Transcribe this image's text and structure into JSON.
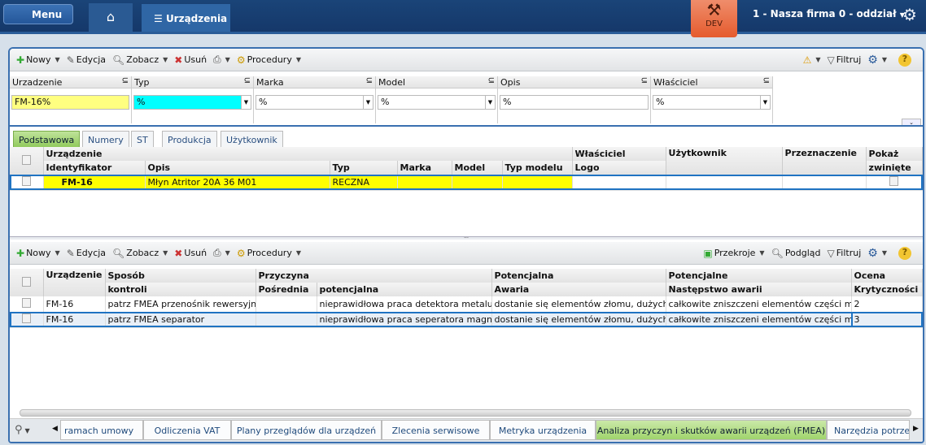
{
  "topbar": {
    "menu_label": "Menu",
    "home_icon": "home-icon",
    "active_tab": "Urządzenia",
    "dev_label": "DEV",
    "company": "1 - Nasza firma 0 - oddział",
    "colors": {
      "bar": "#16396a",
      "dev": "#e8623a"
    }
  },
  "toolbar1": {
    "new": "Nowy",
    "edit": "Edycja",
    "view": "Zobacz",
    "delete": "Usuń",
    "procedures": "Procedury",
    "filter": "Filtruj"
  },
  "filters": [
    {
      "label": "Urzadzenie",
      "value": "FM-16%"
    },
    {
      "label": "Typ",
      "value": "%"
    },
    {
      "label": "Marka",
      "value": "%"
    },
    {
      "label": "Model",
      "value": "%"
    },
    {
      "label": "Opis",
      "value": "%"
    },
    {
      "label": "Właściciel",
      "value": "%"
    }
  ],
  "tabs1": [
    "Podstawowa",
    "Numery",
    "ST",
    "Produkcja",
    "Użytkownik"
  ],
  "grid1": {
    "group": "Urządzenie",
    "headers": [
      "Identyfikator",
      "Opis",
      "Typ",
      "Marka",
      "Model",
      "Typ modelu"
    ],
    "owner": "Właściciel",
    "logo": "Logo",
    "user": "Użytkownik",
    "purpose": "Przeznaczenie",
    "show1": "Pokaż",
    "show2": "zwinięte",
    "rows": [
      {
        "id": "FM-16",
        "opis": "Młyn Atritor 20A  36 M01",
        "typ": "RECZNA"
      }
    ]
  },
  "toolbar2": {
    "new": "Nowy",
    "edit": "Edycja",
    "view": "Zobacz",
    "delete": "Usuń",
    "procedures": "Procedury",
    "sections": "Przekroje",
    "preview": "Podgląd",
    "filter": "Filtruj"
  },
  "grid2": {
    "h": {
      "dev": "Urządzenie",
      "method1": "Sposób",
      "method2": "kontroli",
      "cause": "Przyczyna",
      "indirect": "Pośrednia",
      "potential": "potencjalna",
      "pot1": "Potencjalna",
      "failure": "Awaria",
      "pot2": "Potencjalne",
      "consequence": "Następstwo awarii",
      "rating1": "Ocena",
      "rating2": "Krytyczności"
    },
    "rows": [
      {
        "dev": "FM-16",
        "method": "patrz FMEA przenośnik rewersyjny z",
        "indirect": "",
        "potential": "nieprawidłowa praca detektora metalu",
        "failure": "dostanie się elementów złomu, dużych kar",
        "consequence": "całkowite zniszczeni elementów części młyna",
        "rating": "2"
      },
      {
        "dev": "FM-16",
        "method": "patrz FMEA separator",
        "indirect": "",
        "potential": "nieprawidłowa praca seperatora magnetyc",
        "failure": "dostanie się elementów złomu, dużych kar",
        "consequence": "całkowite zniszczeni elementów części młyna",
        "rating": "3"
      }
    ]
  },
  "bottom_tabs": [
    "ramach umowy",
    "Odliczenia VAT",
    "Plany przeglądów dla urządzeń",
    "Zlecenia serwisowe",
    "Metryka urządzenia",
    "Analiza przyczyn i skutków awarii urządzeń (FMEA)",
    "Narzędzia potrzeb"
  ],
  "bottom_active": 5
}
